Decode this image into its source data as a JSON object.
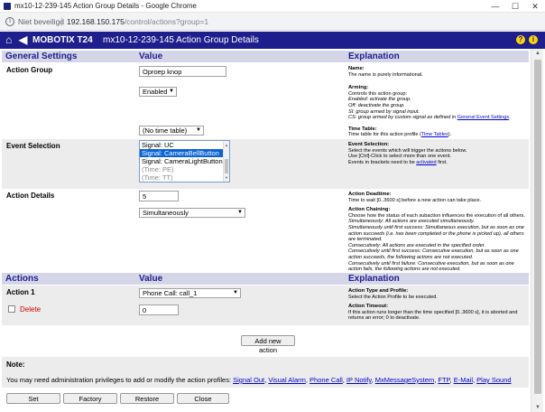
{
  "window": {
    "title": "mx10-12-239-145 Action Group Details - Google Chrome",
    "min": "—",
    "max": "☐",
    "close": "✕"
  },
  "address": {
    "security": "Niet beveiligd",
    "host": "192.168.150.175",
    "path": "/control/actions?group=1"
  },
  "header": {
    "brand": "MOBOTIX T24",
    "title": "mx10-12-239-145 Action Group Details",
    "help1": "?",
    "help2": "i"
  },
  "section1": {
    "col1": "General Settings",
    "col2": "Value",
    "col3": "Explanation"
  },
  "action_group": {
    "label": "Action Group",
    "name_value": "Oproep knop",
    "arming_value": "Enabled",
    "timetable_value": "(No time table)",
    "expl_name_title": "Name:",
    "expl_name_text": "The name is purely informational.",
    "expl_arming_title": "Arming:",
    "expl_arming_l1": "Controls this action group:",
    "expl_arming_l2": "Enabled: activate the group.",
    "expl_arming_l3": "Off: deactivate the group.",
    "expl_arming_l4": "SI: group armed by signal input.",
    "expl_arming_l5": "CS: group armed by custom signal as defined in",
    "expl_arming_link": "General Event Settings",
    "expl_time_title": "Time Table:",
    "expl_time_text": "Time table for this action profile (",
    "expl_time_link": "Time Tables",
    "expl_time_end": ")."
  },
  "event_selection": {
    "label": "Event Selection",
    "options": [
      "Signal: UC",
      "Signal: CameraBellButton",
      "Signal: CameraLightButton",
      "(Time: PE)",
      "(Time: TT)"
    ],
    "expl_title": "Event Selection:",
    "expl_l1": "Select the events which will trigger the actions below.",
    "expl_l2": "Use [Ctrl]-Click to select more than one event.",
    "expl_l3": "Events in brackets need to be",
    "expl_link": "activated",
    "expl_l3_end": "first."
  },
  "action_details": {
    "label": "Action Details",
    "deadtime_value": "5",
    "chaining_value": "Simultaneously",
    "expl_dead_title": "Action Deadtime:",
    "expl_dead_text": "Time to wait [0..3600 s] before a new action can take place.",
    "expl_chain_title": "Action Chaining:",
    "expl_chain_l1": "Choose how the status of each subaction influences the execution of all others.",
    "expl_chain_l2": "Simultaneously: All actions are executed simultaneously.",
    "expl_chain_l3": "Simultaneously until first success: Simultaneous execution, but as soon as one action succeeds (i.e. has been completed or the phone is picked up), all others are terminated.",
    "expl_chain_l4": "Consecutively: All actions are executed in the specified order.",
    "expl_chain_l5": "Consecutively until first success: Consecutive execution, but as soon as one action succeeds, the following actions are not executed.",
    "expl_chain_l6": "Consecutively until first failure: Consecutive execution, but as soon as one action fails, the following actions are not executed."
  },
  "section2": {
    "col1": "Actions",
    "col2": "Value",
    "col3": "Explanation"
  },
  "action1": {
    "label": "Action 1",
    "profile_value": "Phone Call: call_1",
    "delete_label": "Delete",
    "timeout_value": "0",
    "expl_type_title": "Action Type and Profile:",
    "expl_type_text": "Select the Action Profile to be executed.",
    "expl_timeout_title": "Action Timeout:",
    "expl_timeout_text": "If this action runs longer than the time specified [0..3600 s], it is aborted and returns an error; 0 to deactivate."
  },
  "add_action_label": "Add new action",
  "note": {
    "title": "Note:",
    "text": "You may need administration privileges to add or modify the action profiles:",
    "links": [
      "Signal Out",
      "Visual Alarm",
      "Phone Call",
      "IP Notify",
      "MxMessageSystem",
      "FTP",
      "E-Mail",
      "Play Sound"
    ]
  },
  "footer": {
    "set": "Set",
    "factory": "Factory",
    "restore": "Restore",
    "close": "Close"
  }
}
